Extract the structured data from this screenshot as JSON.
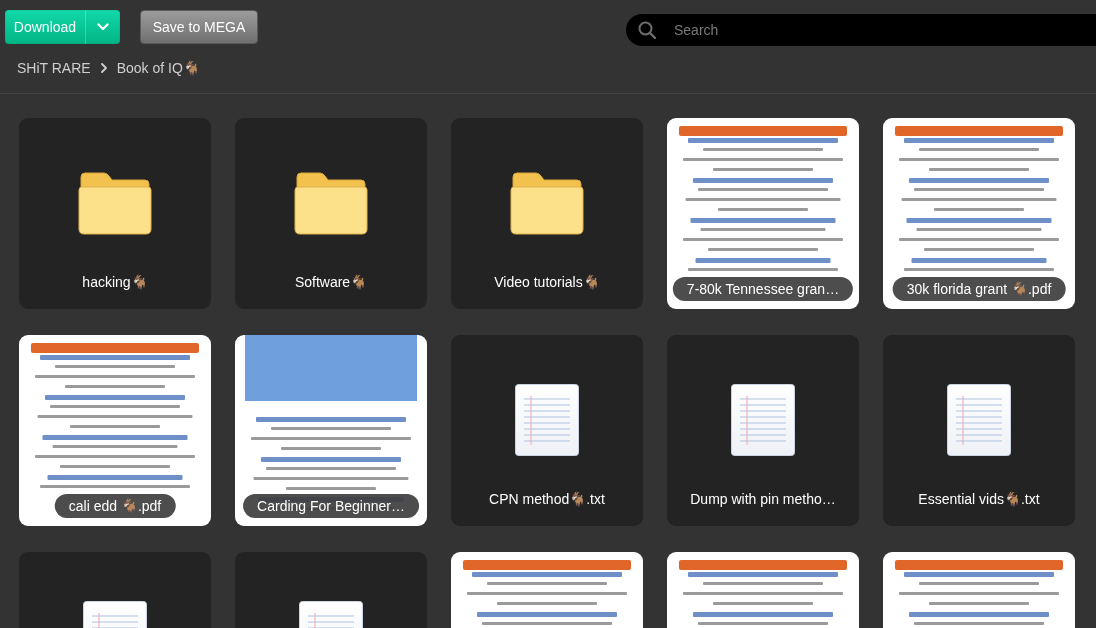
{
  "toolbar": {
    "download_button": "Download",
    "save_button": "Save to MEGA"
  },
  "search": {
    "placeholder": "Search"
  },
  "breadcrumb": [
    "SHiT RARE",
    "Book of IQ🐐"
  ],
  "items": [
    {
      "kind": "folder",
      "name": "hacking🐐"
    },
    {
      "kind": "folder",
      "name": "Software🐐"
    },
    {
      "kind": "folder",
      "name": "Video tutorials🐐"
    },
    {
      "kind": "page_preview",
      "name": "7-80k Tennessee gran…"
    },
    {
      "kind": "page_preview",
      "name": "30k florida grant 🐐.pdf"
    },
    {
      "kind": "page_preview",
      "name": "cali edd 🐐.pdf"
    },
    {
      "kind": "photo_preview",
      "name": "Carding For Beginner…"
    },
    {
      "kind": "file",
      "name": "CPN method🐐.txt"
    },
    {
      "kind": "file",
      "name": "Dump with pin metho…"
    },
    {
      "kind": "file",
      "name": "Essential vids🐐.txt"
    },
    {
      "kind": "file"
    },
    {
      "kind": "file"
    },
    {
      "kind": "page_preview"
    },
    {
      "kind": "page_preview"
    },
    {
      "kind": "page_preview"
    }
  ]
}
